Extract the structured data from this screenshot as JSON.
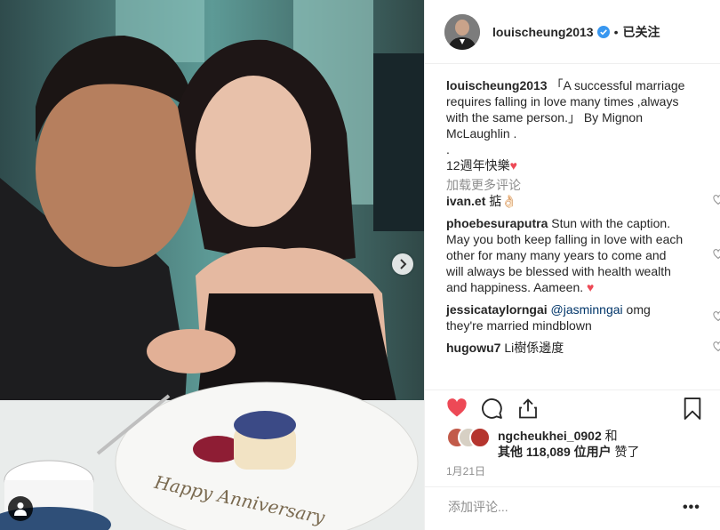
{
  "photo": {
    "cake_text": "Happy Anniversary"
  },
  "header": {
    "username": "louischeung2013",
    "dot": "•",
    "follow_state": "已关注"
  },
  "caption": {
    "username": "louischeung2013",
    "text": "「A successful marriage requires falling in love many times ,always with the same person.」 By Mignon McLaughlin .",
    "line2": ".",
    "line3": "12週年快樂",
    "heart": "♥"
  },
  "load_more": "加载更多评论",
  "comments": [
    {
      "username": "ivan.et",
      "text": "掂👌🏻"
    },
    {
      "username": "phoebesuraputra",
      "text": "Stun with the caption. May you both keep falling in love with each other for many many years to come and will always be blessed with health wealth and happiness. Aameen.",
      "heart": "♥"
    },
    {
      "username": "jessicataylorngai",
      "mention": "@jasminngai",
      "text": "omg they're married mindblown"
    },
    {
      "username": "hugowu7",
      "text": "Li樹係邊度"
    }
  ],
  "likes": {
    "liker": "ngcheukhei_0902",
    "and": "和",
    "others_prefix": "其他",
    "count": "118,089",
    "others_suffix": "位用户",
    "liked": "赞了"
  },
  "date": "1月21日",
  "add_comment": {
    "placeholder": "添加评论...",
    "more": "•••"
  },
  "colors": {
    "accent_red": "#ed4956",
    "verified_blue": "#3897f0",
    "muted": "#8e8e8e",
    "border": "#efefef"
  },
  "icons": [
    "next-arrow-icon",
    "user-tag-icon",
    "verified-badge-icon",
    "heart-icon",
    "comment-icon",
    "share-icon",
    "bookmark-icon",
    "more-icon"
  ]
}
